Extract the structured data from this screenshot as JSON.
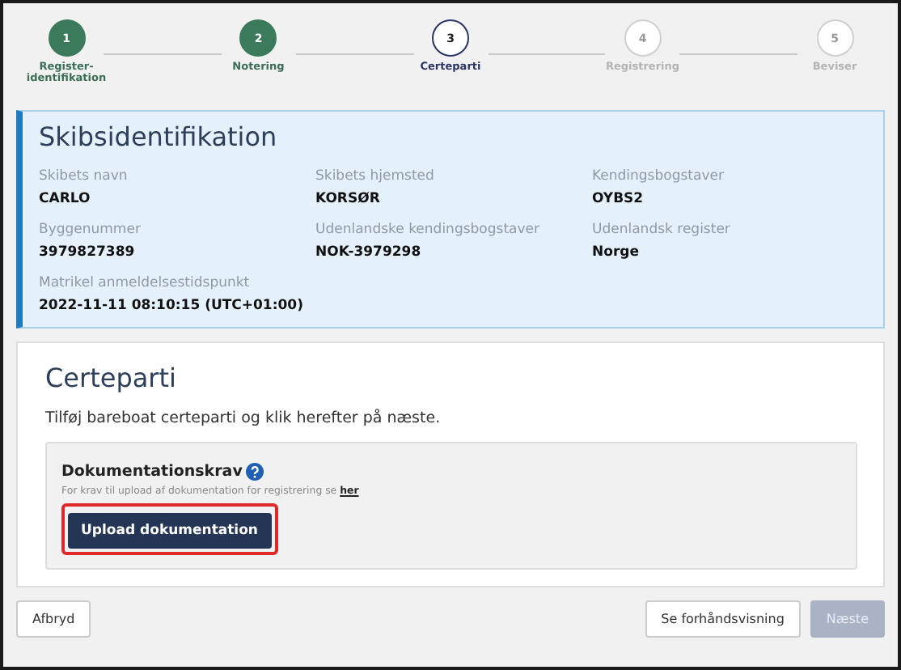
{
  "stepper": [
    {
      "number": "1",
      "label": "Register-identifikation",
      "completed": true,
      "selected": false
    },
    {
      "number": "2",
      "label": "Notering",
      "completed": true,
      "selected": false
    },
    {
      "number": "3",
      "label": "Certeparti",
      "completed": false,
      "selected": true
    },
    {
      "number": "4",
      "label": "Registrering",
      "completed": false,
      "selected": false
    },
    {
      "number": "5",
      "label": "Beviser",
      "completed": false,
      "selected": false
    }
  ],
  "ship_identification": {
    "title": "Skibsidentifikation",
    "fields": [
      {
        "label": "Skibets navn",
        "value": "CARLO"
      },
      {
        "label": "Skibets hjemsted",
        "value": "KORSØR"
      },
      {
        "label": "Kendingsbogstaver",
        "value": "OYBS2"
      },
      {
        "label": "Byggenummer",
        "value": "3979827389"
      },
      {
        "label": "Udenlandske kendingsbogstaver",
        "value": "NOK-3979298"
      },
      {
        "label": "Udenlandsk register",
        "value": "Norge"
      },
      {
        "label": "Matrikel anmeldelsestidspunkt",
        "value": "2022-11-11 08:10:15 (UTC+01:00)"
      }
    ]
  },
  "charter": {
    "title": "Certeparti",
    "description": "Tilføj bareboat certeparti og klik herefter på næste.",
    "requirements": {
      "heading": "Dokumentationskrav",
      "hint": "For krav til upload af dokumentation for registrering se",
      "link": "her",
      "button": {
        "label": "Upload dokumentation",
        "highlighted": true
      }
    }
  },
  "footer": {
    "cancel": {
      "label": "Afbryd",
      "disabled": false
    },
    "preview": {
      "label": "Se forhåndsvisning",
      "disabled": false
    },
    "next": {
      "label": "Næste",
      "disabled": true
    }
  }
}
